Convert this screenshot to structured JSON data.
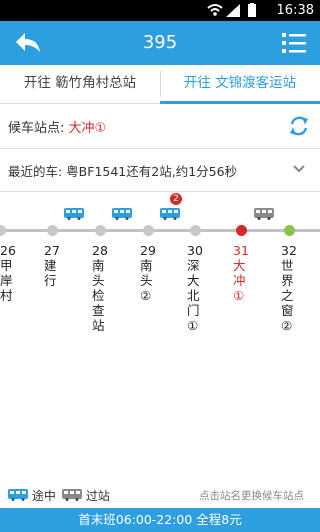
{
  "status_bar": {
    "time": "16:38"
  },
  "header": {
    "title": "395"
  },
  "tabs": [
    {
      "label": "开往 簕竹角村总站"
    },
    {
      "label": "开往 文锦渡客运站"
    }
  ],
  "waiting_stop": {
    "label": "候车站点:",
    "stop": "大冲①"
  },
  "nearest_bus": {
    "text": "最近的车: 粤BF1541还有2站,约1分56秒"
  },
  "stops": [
    {
      "number": "26",
      "name": "甲岸村"
    },
    {
      "number": "27",
      "name": "建行"
    },
    {
      "number": "28",
      "name": "南头检查站"
    },
    {
      "number": "29",
      "name": "南头②"
    },
    {
      "number": "30",
      "name": "深大北门①"
    },
    {
      "number": "31",
      "name": "大冲①"
    },
    {
      "number": "32",
      "name": "世界之窗②"
    }
  ],
  "bus_badge": "2",
  "legend": {
    "en_route": "途中",
    "passed": "过站",
    "hint": "点击站名更换候车站点"
  },
  "footer": {
    "text": "首末班06:00-22:00 全程8元"
  },
  "colors": {
    "brand": "#2d9ee0",
    "current_stop": "#d42a2a",
    "next_stop": "#8bc34a"
  }
}
